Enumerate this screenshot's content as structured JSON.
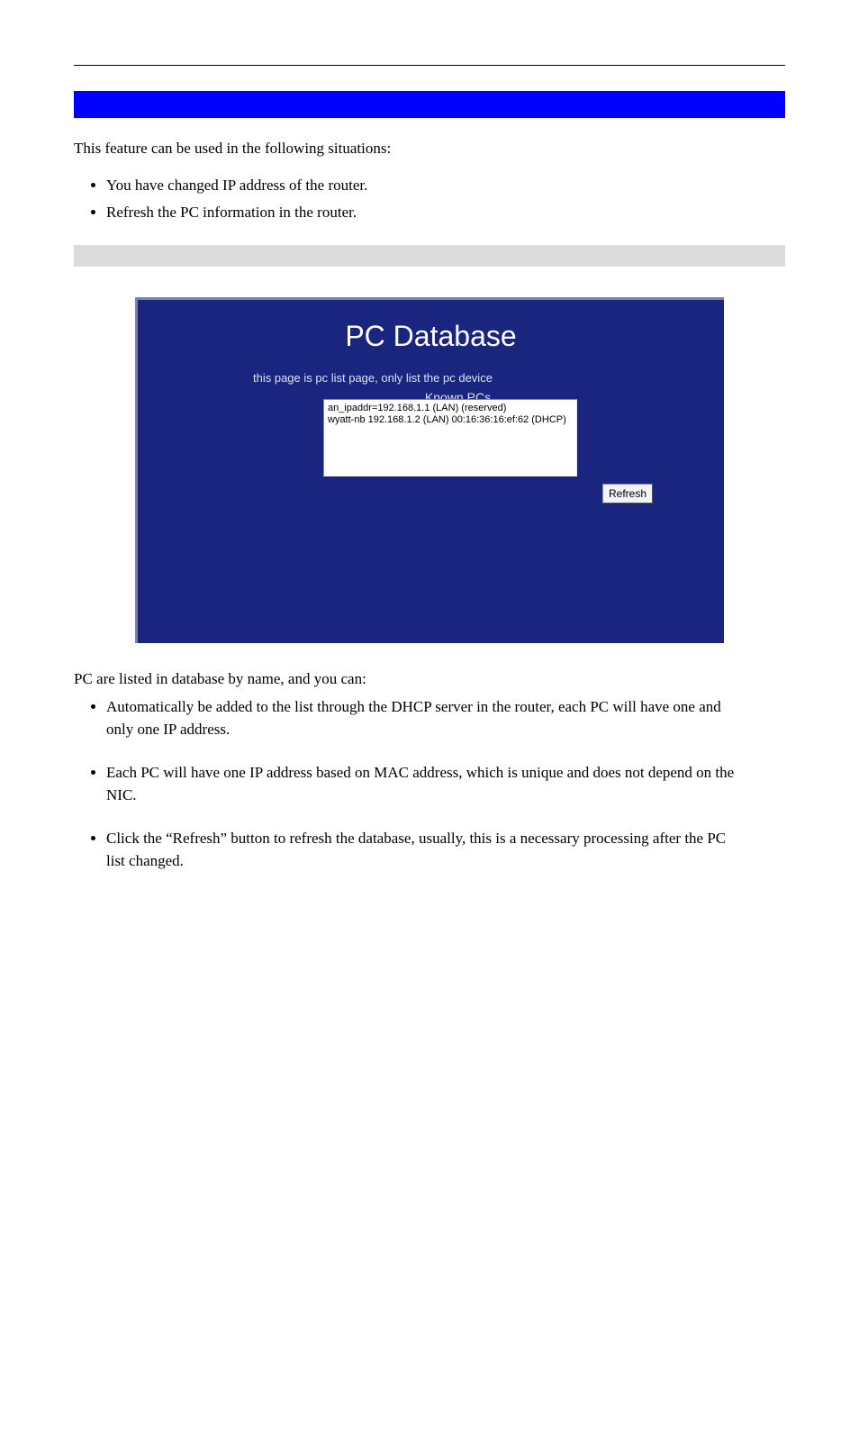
{
  "intro": "This feature can be used in the following situations:",
  "bullets_top": {
    "item1": "You have changed IP address of the router.",
    "item2": "Refresh the PC information in the router."
  },
  "router_ui": {
    "title": "PC Database",
    "subtitle": "this page is pc list page, only list the pc device",
    "known_label": "Known PCs",
    "rows": {
      "r0": "an_ipaddr=192.168.1.1 (LAN) (reserved)",
      "r1": "wyatt-nb 192.168.1.2 (LAN) 00:16:36:16:ef:62 (DHCP)"
    },
    "refresh": "Refresh"
  },
  "below_intro": "PC are listed in database by name, and you can:",
  "bullets_bottom": {
    "n1": "Automatically be added to the list through the DHCP server in the router, each PC will have one and only one IP address.",
    "n2": "Each PC will have one IP address based on MAC address, which is unique and does not depend on the NIC.",
    "n3": "Click the “Refresh” button to refresh the database, usually, this is a necessary processing after the PC list changed."
  }
}
